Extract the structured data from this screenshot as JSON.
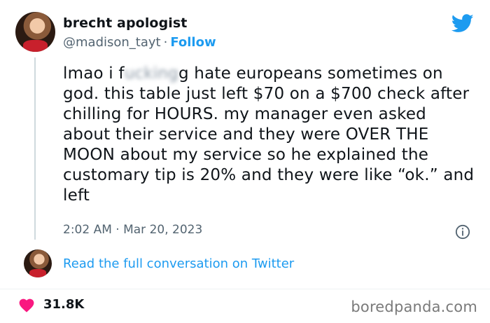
{
  "author": {
    "display_name": "brecht apologist",
    "handle": "@madison_tayt",
    "separator": "·",
    "follow_label": "Follow"
  },
  "tweet": {
    "text_before_blur": "lmao i f",
    "blurred_text": "ucking",
    "text_after_blur": "g hate europeans sometimes on god. this table just left $70 on a $700 check after chilling for HOURS. my manager even asked about their service and they were OVER THE MOON about my service so he explained the customary tip is 20% and they were like “ok.” and left",
    "timestamp": "2:02 AM · Mar 20, 2023"
  },
  "footer": {
    "read_conversation_label": "Read the full conversation on Twitter",
    "likes": "31.8K"
  },
  "watermark": "boredpanda.com",
  "colors": {
    "accent": "#1d9bf0",
    "heart": "#f91880",
    "muted": "#536471"
  },
  "icons": [
    "twitter-logo-icon",
    "info-icon",
    "heart-icon"
  ]
}
